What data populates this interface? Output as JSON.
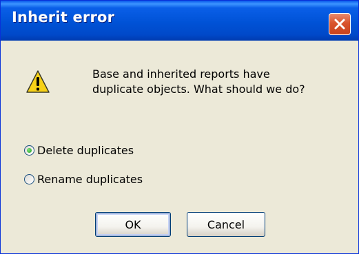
{
  "window": {
    "title": "Inherit error"
  },
  "icons": {
    "close": "close-icon",
    "warning": "warning-icon"
  },
  "message": {
    "line1": "Base and inherited reports have",
    "line2": "duplicate objects. What should we do?"
  },
  "options": [
    {
      "label": "Delete duplicates",
      "checked": true
    },
    {
      "label": "Rename duplicates",
      "checked": false
    }
  ],
  "buttons": {
    "ok": "OK",
    "cancel": "Cancel"
  },
  "colors": {
    "titlebar": "#0052d6",
    "close_button": "#d9532c",
    "dialog_background": "#ece9d8",
    "warning_yellow": "#f7d117"
  }
}
